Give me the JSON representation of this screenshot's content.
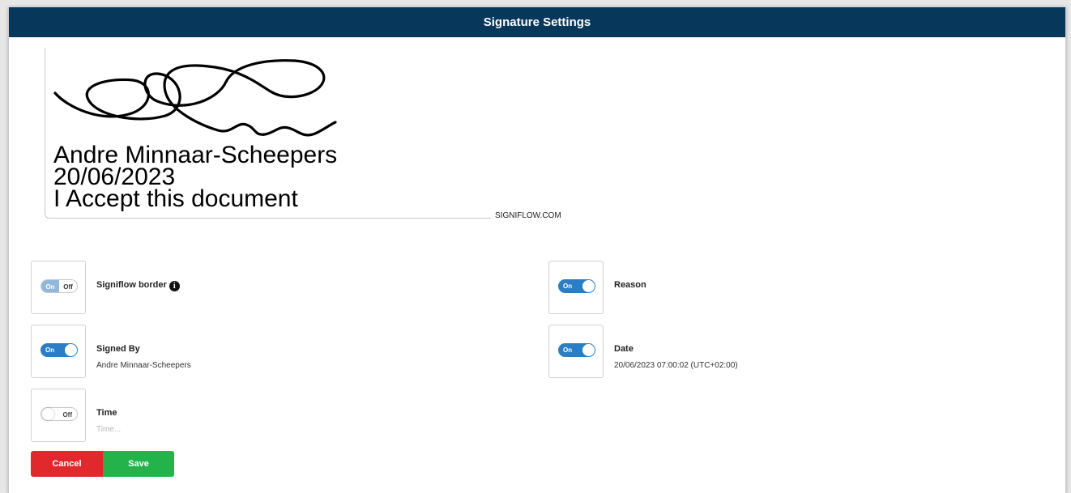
{
  "dialog": {
    "title": "Signature Settings"
  },
  "signature_preview": {
    "name_line": "Andre Minnaar-Scheepers",
    "date_line": "20/06/2023",
    "reason_line": "I Accept this document",
    "brand": "SIGNIFLOW.COM"
  },
  "options": {
    "border": {
      "label": "Signiflow border",
      "toggle_on_text": "On",
      "toggle_off_text": "Off",
      "state": "split"
    },
    "reason": {
      "label": "Reason",
      "toggle_text": "On",
      "state": "on"
    },
    "signed_by": {
      "label": "Signed By",
      "value": "Andre Minnaar-Scheepers",
      "toggle_text": "On",
      "state": "on"
    },
    "date": {
      "label": "Date",
      "value": "20/06/2023 07:00:02 (UTC+02:00)",
      "toggle_text": "On",
      "state": "on"
    },
    "time": {
      "label": "Time",
      "placeholder": "Time...",
      "toggle_text": "Off",
      "state": "off"
    }
  },
  "actions": {
    "cancel_label": "Cancel",
    "save_label": "Save"
  },
  "colors": {
    "header": "#07375a",
    "toggle_on": "#2a7ec5",
    "cancel": "#e0282d",
    "save": "#24b24b"
  },
  "icons": {
    "info": "info-icon"
  }
}
